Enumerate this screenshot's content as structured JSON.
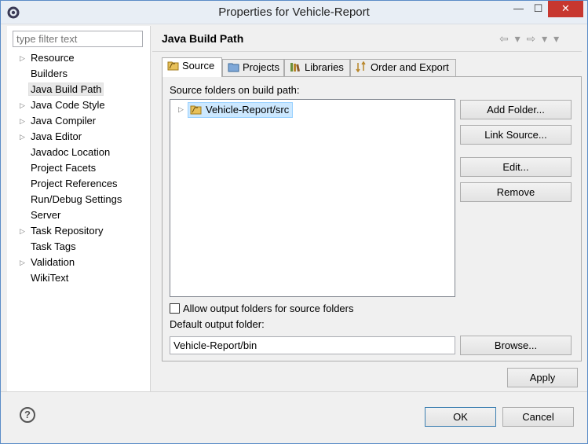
{
  "window": {
    "title": "Properties for Vehicle-Report",
    "min": "—",
    "max": "☐",
    "close": "✕"
  },
  "left": {
    "filter_placeholder": "type filter text",
    "tree": [
      {
        "label": "Resource",
        "expandable": true
      },
      {
        "label": "Builders",
        "expandable": false
      },
      {
        "label": "Java Build Path",
        "expandable": false,
        "selected": true
      },
      {
        "label": "Java Code Style",
        "expandable": true
      },
      {
        "label": "Java Compiler",
        "expandable": true
      },
      {
        "label": "Java Editor",
        "expandable": true
      },
      {
        "label": "Javadoc Location",
        "expandable": false
      },
      {
        "label": "Project Facets",
        "expandable": false
      },
      {
        "label": "Project References",
        "expandable": false
      },
      {
        "label": "Run/Debug Settings",
        "expandable": false
      },
      {
        "label": "Server",
        "expandable": false
      },
      {
        "label": "Task Repository",
        "expandable": true
      },
      {
        "label": "Task Tags",
        "expandable": false
      },
      {
        "label": "Validation",
        "expandable": true
      },
      {
        "label": "WikiText",
        "expandable": false
      }
    ]
  },
  "page": {
    "title": "Java Build Path",
    "nav": "⇦ ▾ ⇨ ▾ ▾",
    "tabs": [
      "Source",
      "Projects",
      "Libraries",
      "Order and Export"
    ],
    "source_label": "Source folders on build path:",
    "source_item": "Vehicle-Report/src",
    "buttons": {
      "add_folder": "Add Folder...",
      "link_source": "Link Source...",
      "edit": "Edit...",
      "remove": "Remove",
      "browse": "Browse..."
    },
    "allow_output": "Allow output folders for source folders",
    "default_output_label": "Default output folder:",
    "default_output_value": "Vehicle-Report/bin",
    "apply": "Apply"
  },
  "footer": {
    "help": "?",
    "ok": "OK",
    "cancel": "Cancel"
  },
  "colors": {
    "accent": "#3c7fb1",
    "selection": "#cce8ff",
    "close": "#c7372f"
  }
}
